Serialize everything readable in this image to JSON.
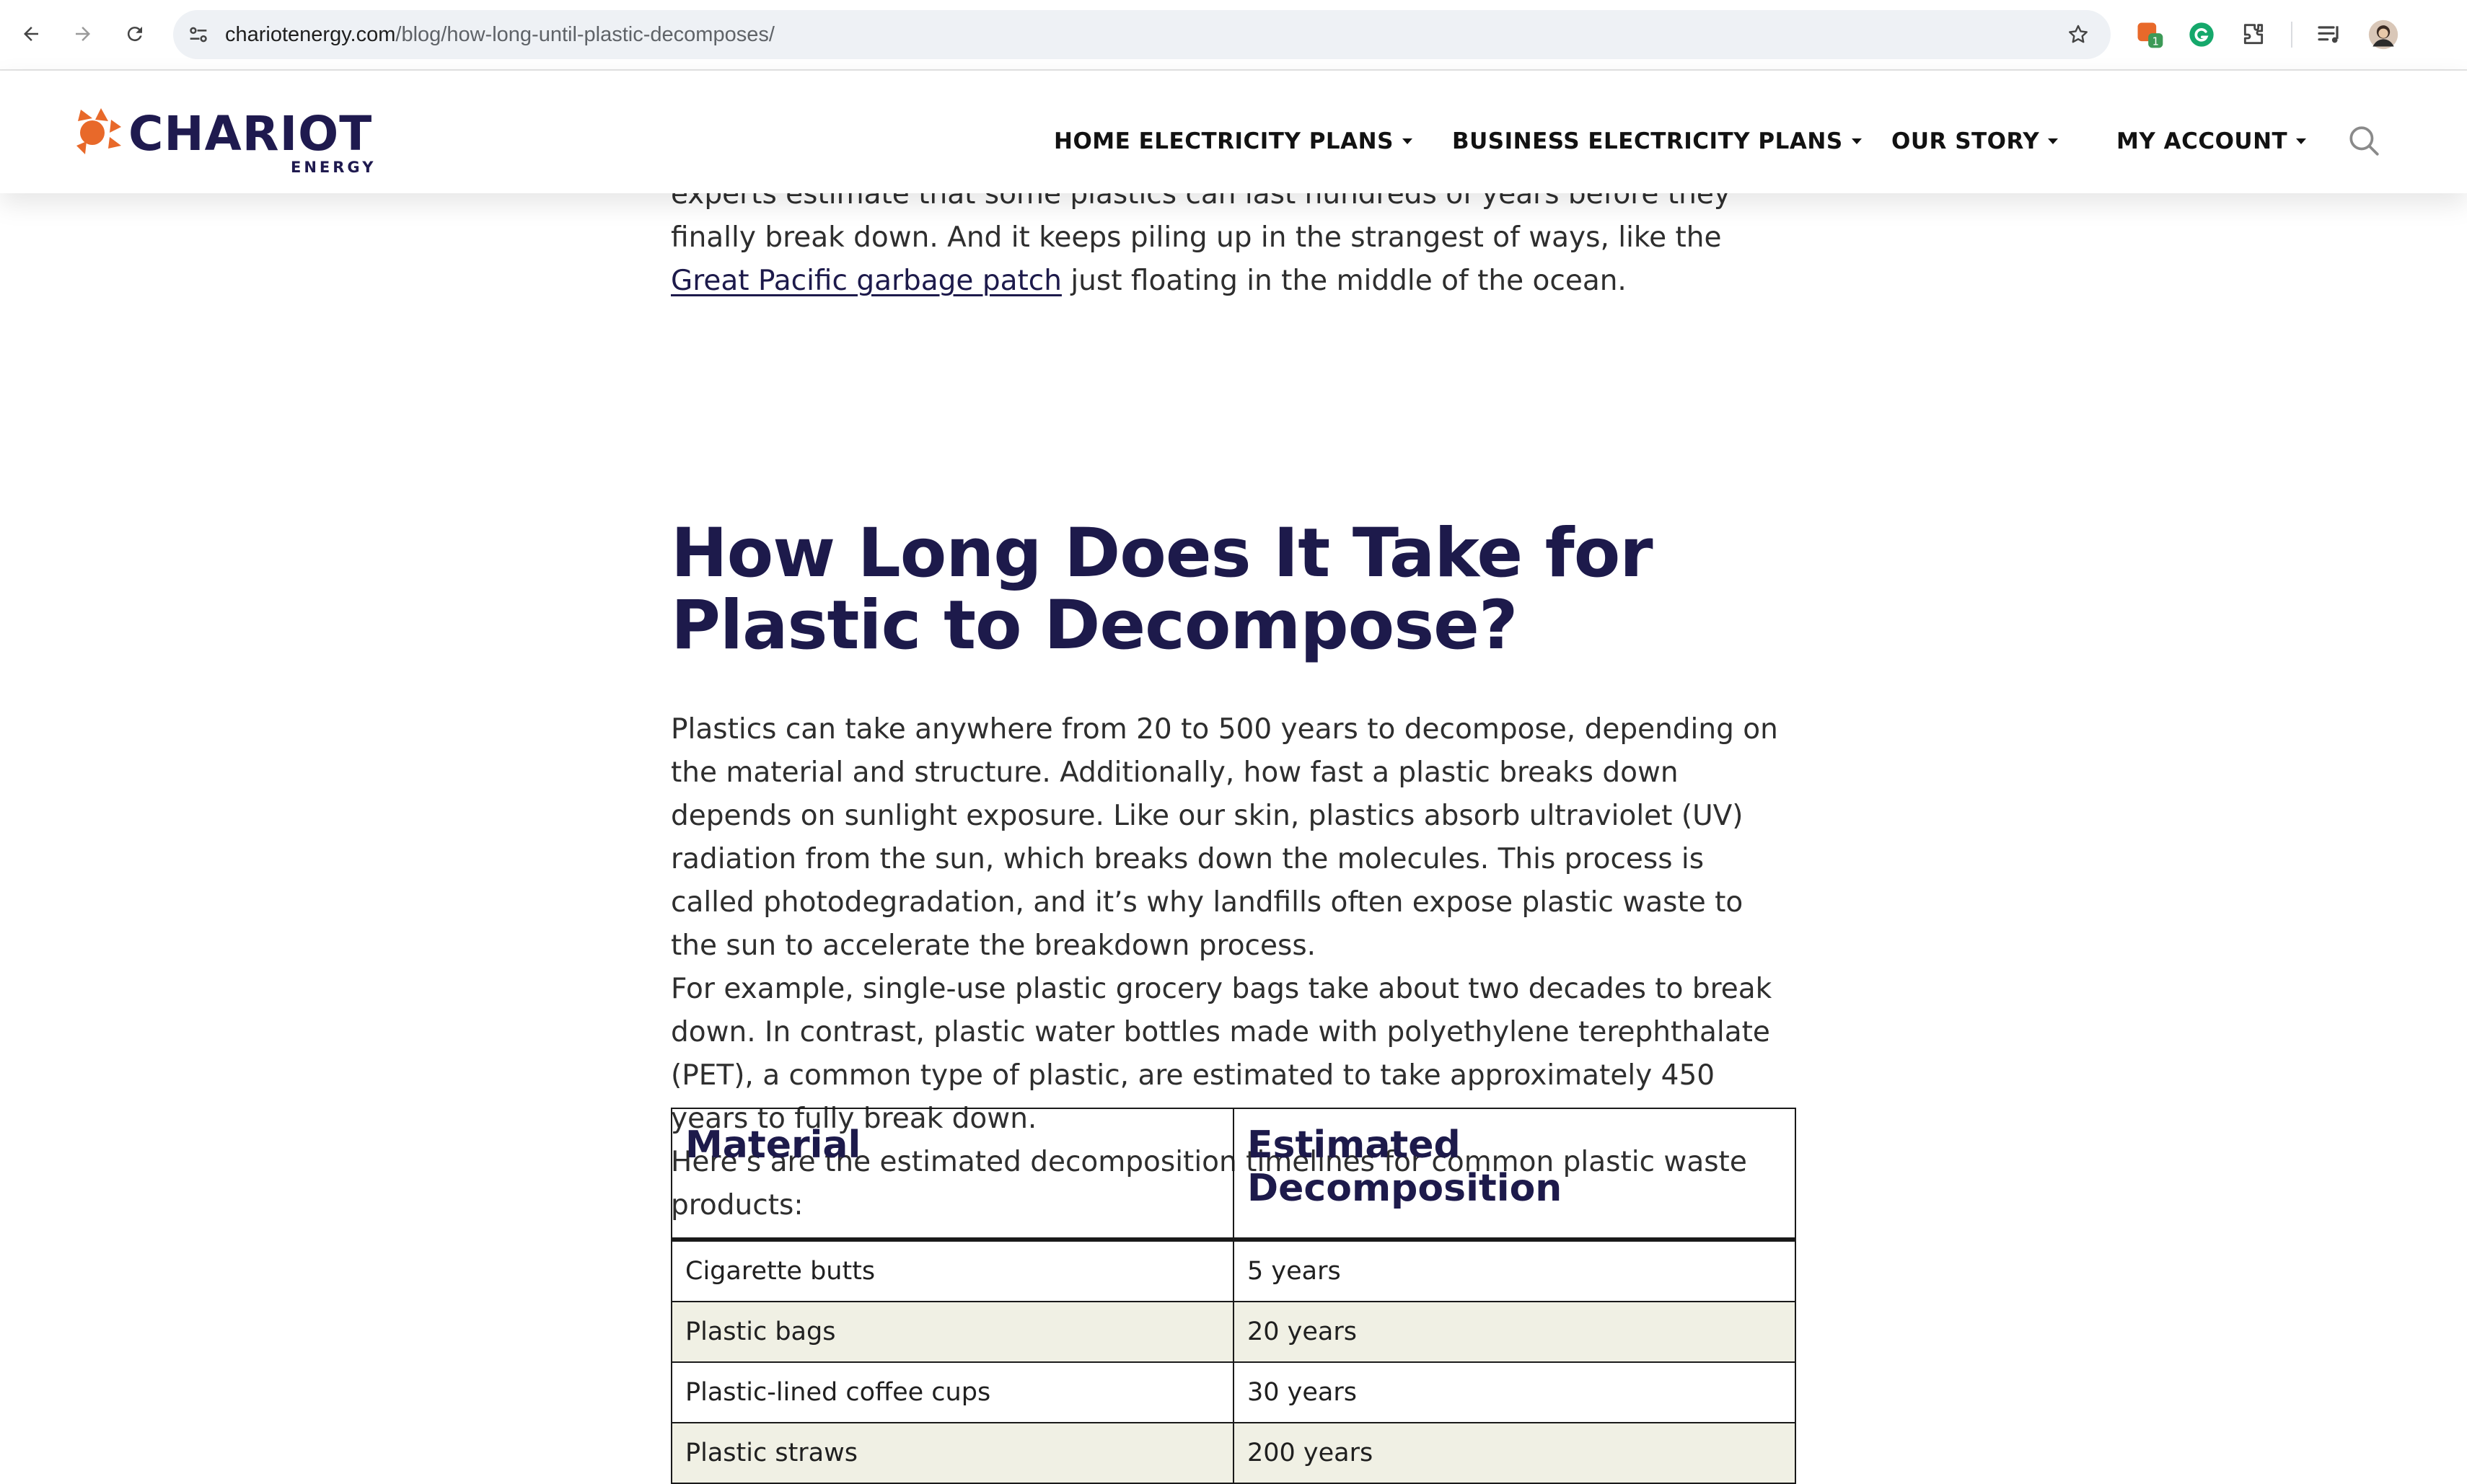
{
  "browser": {
    "url_host": "chariotenergy.com",
    "url_path": "/blog/how-long-until-plastic-decomposes/",
    "extension_badge": "1"
  },
  "header": {
    "logo_word": "CHARIOT",
    "logo_sub": "ENERGY",
    "nav": [
      {
        "label": "HOME ELECTRICITY PLANS"
      },
      {
        "label": "BUSINESS ELECTRICITY PLANS"
      },
      {
        "label": "OUR STORY"
      },
      {
        "label": "MY ACCOUNT"
      }
    ]
  },
  "article": {
    "intro": {
      "before": "experts estimate that some plastics can last hundreds of years before they finally break down. And it keeps piling up in the strangest of ways, like the ",
      "link": "Great Pacific garbage patch",
      "after": " just floating in the middle of the ocean."
    },
    "heading": "How Long Does It Take for Plastic to Decompose?",
    "paragraphs": [
      "Plastics can take anywhere from 20 to 500 years to decompose, depending on the material and structure. Additionally, how fast a plastic breaks down depends on sunlight exposure. Like our skin, plastics absorb ultraviolet (UV) radiation from the sun, which breaks down the molecules. This process is called photodegradation, and it’s why landfills often expose plastic waste to the sun to accelerate the breakdown process.",
      "For example, single-use plastic grocery bags take about two decades to break down. In contrast, plastic water bottles made with polyethylene terephthalate (PET), a common type of plastic, are estimated to take approximately 450 years to fully break down.",
      "Here’s are the estimated decomposition timelines for common plastic waste products:"
    ],
    "table": {
      "headers": [
        "Material",
        "Estimated Decomposition"
      ],
      "rows": [
        [
          "Cigarette butts",
          "5 years"
        ],
        [
          "Plastic bags",
          "20 years"
        ],
        [
          "Plastic-lined coffee cups",
          "30 years"
        ],
        [
          "Plastic straws",
          "200 years"
        ]
      ]
    }
  },
  "colors": {
    "brand_navy": "#1d1a4b",
    "brand_orange": "#e8692a",
    "table_alt_row": "#f0f0e4"
  },
  "icons": [
    "back-arrow-icon",
    "forward-arrow-icon",
    "reload-icon",
    "site-settings-icon",
    "bookmark-star-icon",
    "extension-icon",
    "grammarly-icon",
    "puzzle-icon",
    "media-queue-icon",
    "avatar",
    "search-icon"
  ]
}
